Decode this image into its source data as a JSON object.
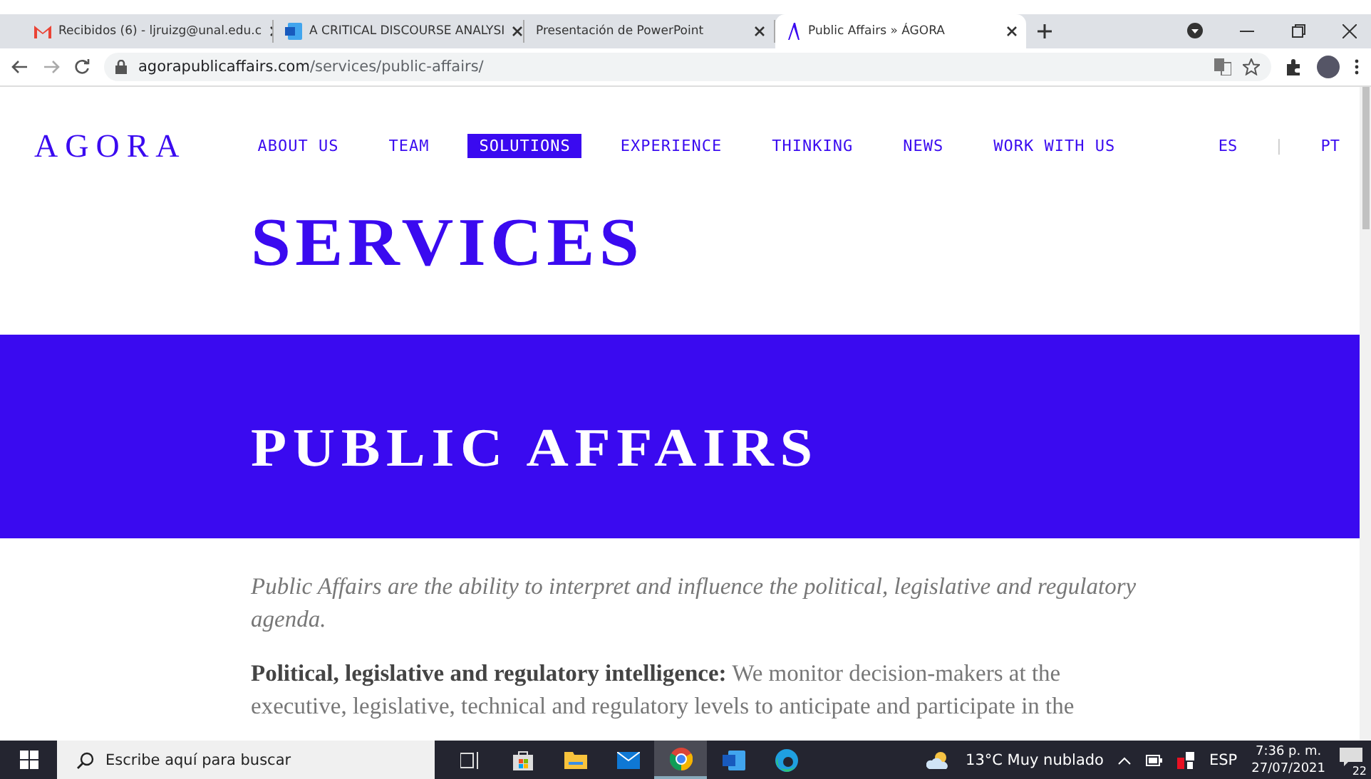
{
  "browser": {
    "tabs": [
      {
        "kind": "gmail",
        "title": "Recibidos (6) - ljruizg@unal.edu.c",
        "selected": false
      },
      {
        "kind": "word",
        "title": "A CRITICAL DISCOURSE ANALYSI",
        "selected": false
      },
      {
        "kind": "plain",
        "title": "Presentación de PowerPoint",
        "selected": false
      },
      {
        "kind": "agora",
        "title": "Public Affairs » ÁGORA",
        "selected": true
      }
    ],
    "url": {
      "domain": "agorapublicaffairs.com",
      "path": "/services/public-affairs/"
    }
  },
  "site": {
    "logo": "AGORA",
    "nav": [
      {
        "label": "ABOUT US",
        "selected": false
      },
      {
        "label": "TEAM",
        "selected": false
      },
      {
        "label": "SOLUTIONS",
        "selected": true
      },
      {
        "label": "EXPERIENCE",
        "selected": false
      },
      {
        "label": "THINKING",
        "selected": false
      },
      {
        "label": "NEWS",
        "selected": false
      },
      {
        "label": "WORK WITH US",
        "selected": false
      }
    ],
    "languages": [
      "ES",
      "PT"
    ],
    "language_separator": "|",
    "page_title": "SERVICES",
    "banner_title": "PUBLIC AFFAIRS",
    "intro": "Public Affairs are the ability to interpret and influence the political, legislative and regulatory agenda.",
    "paragraphs": [
      "**Political, legislative and regulatory intelligence:** We monitor decision-makers at the executive, legislative, technical and regulatory levels to anticipate and participate in the"
    ]
  },
  "taskbar": {
    "search_placeholder": "Escribe aquí para buscar",
    "apps": [
      {
        "kind": "taskview",
        "selected": false
      },
      {
        "kind": "store",
        "selected": false
      },
      {
        "kind": "explorer",
        "selected": false
      },
      {
        "kind": "mail",
        "selected": false
      },
      {
        "kind": "chrome",
        "selected": true
      },
      {
        "kind": "word",
        "selected": false
      },
      {
        "kind": "edge",
        "selected": false
      }
    ],
    "weather": "13°C  Muy nublado",
    "language": "ESP",
    "time": "7:36 p. m.",
    "date": "27/07/2021",
    "notifications": "22"
  }
}
